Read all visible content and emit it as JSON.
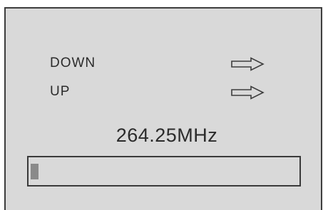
{
  "menu": {
    "items": [
      {
        "label": "DOWN",
        "icon": "right-arrow-icon"
      },
      {
        "label": "UP",
        "icon": "right-arrow-icon"
      }
    ]
  },
  "frequency": {
    "display": "264.25MHz"
  },
  "progress": {
    "fraction": 0.03
  },
  "colors": {
    "background": "#d9d9d9",
    "border": "#3d3d3d",
    "text": "#2b2b2b",
    "progress_fill": "#8a8a8a"
  }
}
